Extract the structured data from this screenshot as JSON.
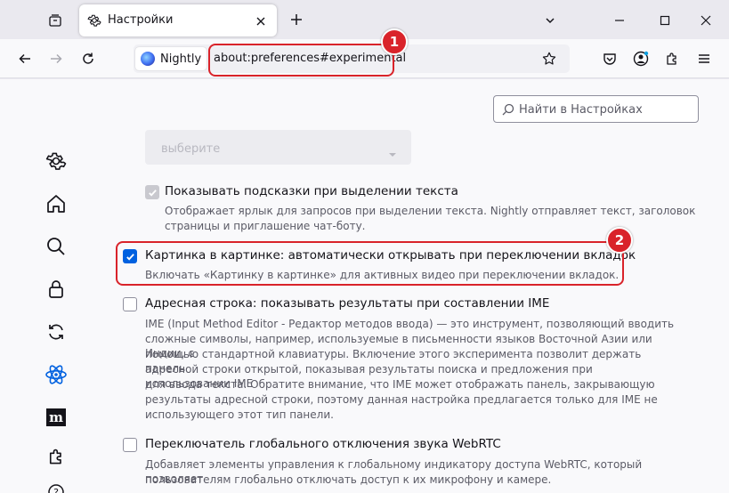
{
  "tabstrip": {
    "tab_title": "Настройки"
  },
  "navbar": {
    "identity_label": "Nightly",
    "url": "about:preferences#experimental"
  },
  "annotations": {
    "badge1": "1",
    "badge2": "2",
    "color": "#d9232a"
  },
  "search": {
    "placeholder": "Найти в Настройках"
  },
  "sidebar": {
    "items": [
      "gear-icon",
      "home-icon",
      "search-icon",
      "lock-icon",
      "sync-icon",
      "experimental-atom-icon",
      "mdn-m-icon",
      "extensions-puzzle-icon",
      "help-icon"
    ]
  },
  "options": {
    "select_value": "выберите",
    "opt1": {
      "title": "Показывать подсказки при выделении текста",
      "desc1": "Отображает ярлык для запросов при выделении текста. Nightly отправляет текст, заголовок",
      "desc2": "страницы и приглашение чат-боту.",
      "checked": true,
      "disabled": true
    },
    "opt2": {
      "title": "Картинка в картинке: автоматически открывать при переключении вкладок",
      "desc": "Включать «Картинку в картинке» для активных видео при переключении вкладок.",
      "checked": true
    },
    "opt3": {
      "title": "Адресная строка: показывать результаты при составлении IME",
      "lines": [
        "IME (Input Method Editor - Редактор методов ввода) — это инструмент, позволяющий вводить",
        "сложные символы, например, используемые в письменности языков Восточной Азии или Индии, с",
        "помощью стандартной клавиатуры. Включение этого эксперимента позволит держать панель",
        "адресной строки открытой, показывая результаты поиска и предложения при использовании IME",
        "для ввода текста. Обратите внимание, что IME может отображать панель, закрывающую",
        "результаты адресной строки, поэтому данная настройка предлагается только для IME не",
        "использующего этот тип панели."
      ],
      "checked": false
    },
    "opt4": {
      "title": "Переключатель глобального отключения звука WebRTC",
      "lines": [
        "Добавляет элементы управления к глобальному индикатору доступа WebRTC, который позволяет",
        "пользователям глобально отключать доступ к их микрофону и камере."
      ],
      "checked": false
    }
  },
  "colors": {
    "accent": "#0061e0",
    "experimental_icon": "#0061e0"
  }
}
